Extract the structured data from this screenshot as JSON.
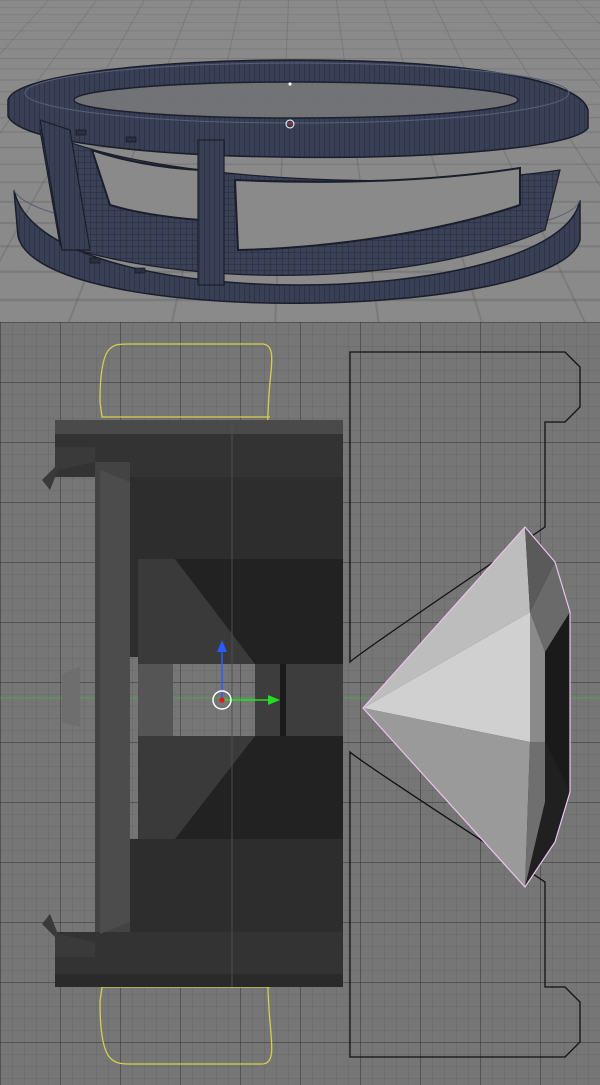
{
  "viewports": {
    "perspective": {
      "name": "perspective",
      "mode": "wireframe-shaded"
    },
    "side": {
      "name": "side-ortho",
      "mode": "solid"
    }
  },
  "colors": {
    "mesh_shaded": "#3b4257",
    "mesh_edges": "#1e2333",
    "solid_dark": "#2c2c2c",
    "solid_mid": "#3a3a3a",
    "solid_light": "#4a4a4a",
    "outline_yellow": "#d6cf4a",
    "outline_black": "#111111",
    "outline_pink": "#f0c0f0",
    "axis_x": "#22dd22",
    "axis_y": "#2b5bff",
    "axis_z_dot": "#e21818",
    "axis_x_line": "#3cb43c"
  },
  "icons": {
    "transform_gizmo": "transform-gizmo-icon",
    "origin": "object-origin-icon",
    "cursor_3d": "3d-cursor-icon"
  }
}
